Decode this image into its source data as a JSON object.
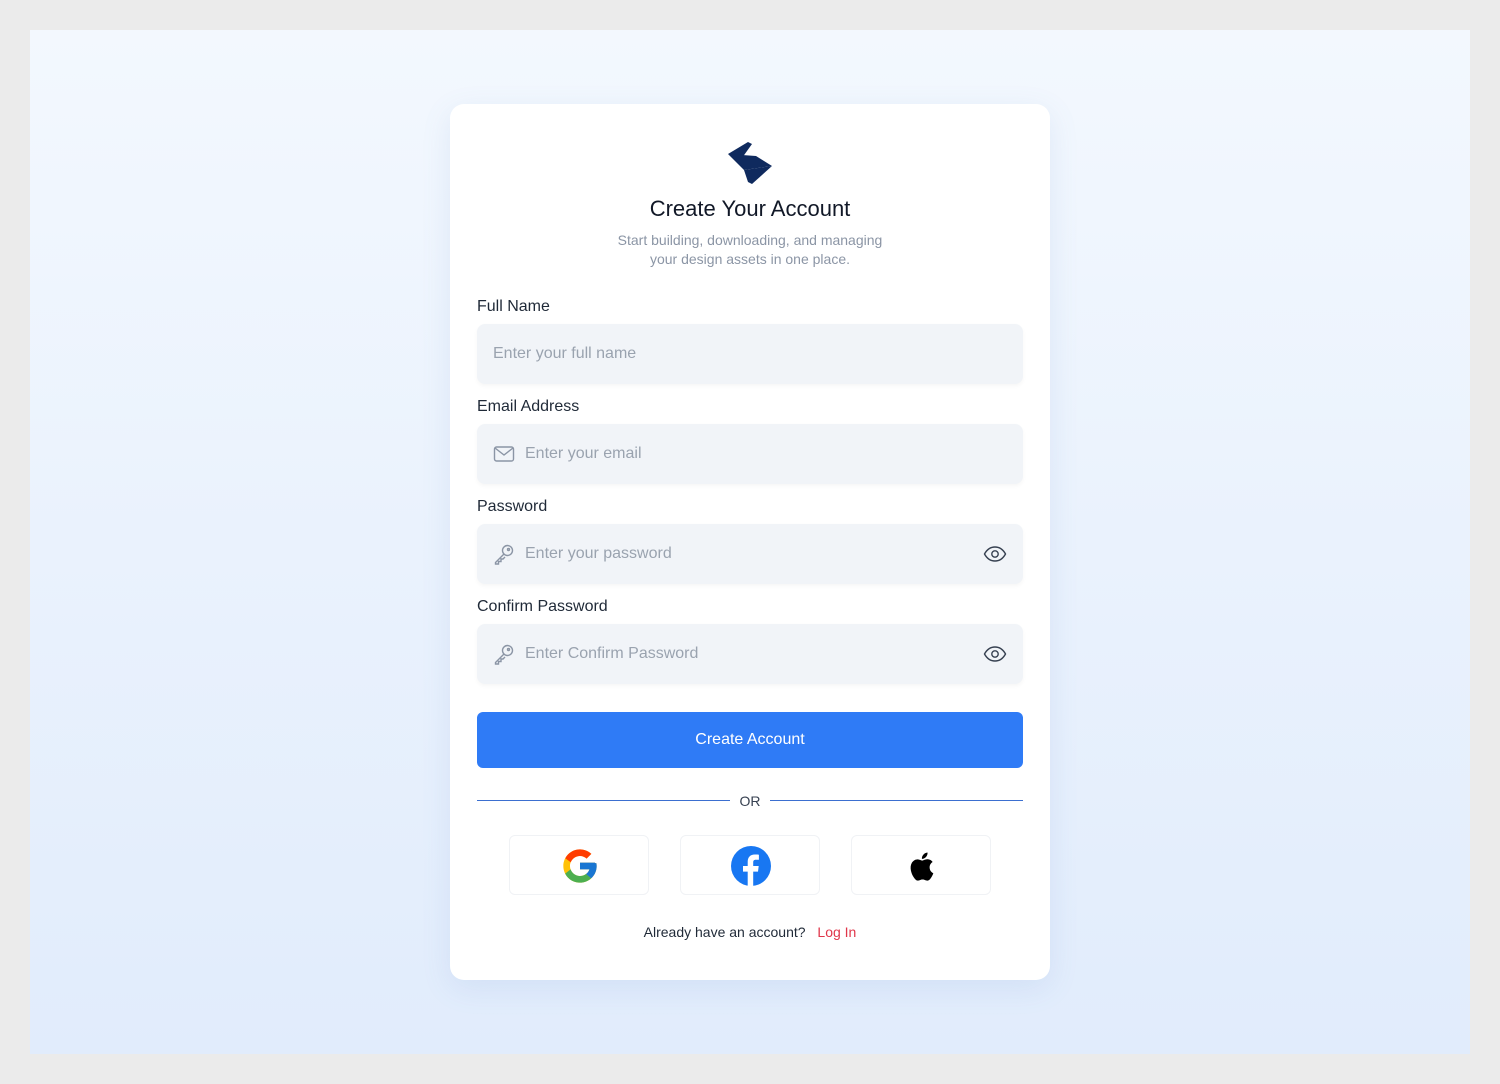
{
  "header": {
    "title": "Create Your Account",
    "subtitle_line1": "Start building, downloading, and managing",
    "subtitle_line2": "your design assets in one place."
  },
  "form": {
    "full_name": {
      "label": "Full Name",
      "placeholder": "Enter your full name",
      "value": ""
    },
    "email": {
      "label": "Email Address",
      "placeholder": "Enter your email",
      "value": ""
    },
    "password": {
      "label": "Password",
      "placeholder": "Enter your password",
      "value": ""
    },
    "confirm_password": {
      "label": "Confirm Password",
      "placeholder": "Enter Confirm Password",
      "value": ""
    },
    "submit_label": "Create Account"
  },
  "divider": {
    "label": "OR"
  },
  "social": [
    {
      "name": "google",
      "icon": "google-icon"
    },
    {
      "name": "facebook",
      "icon": "facebook-icon"
    },
    {
      "name": "apple",
      "icon": "apple-icon"
    }
  ],
  "footer": {
    "prompt": "Already have an account?",
    "link_label": "Log In"
  },
  "colors": {
    "primary": "#2f7bf6",
    "logo": "#0f2a5e",
    "link": "#e0364a",
    "input_bg": "#f1f4f8"
  }
}
